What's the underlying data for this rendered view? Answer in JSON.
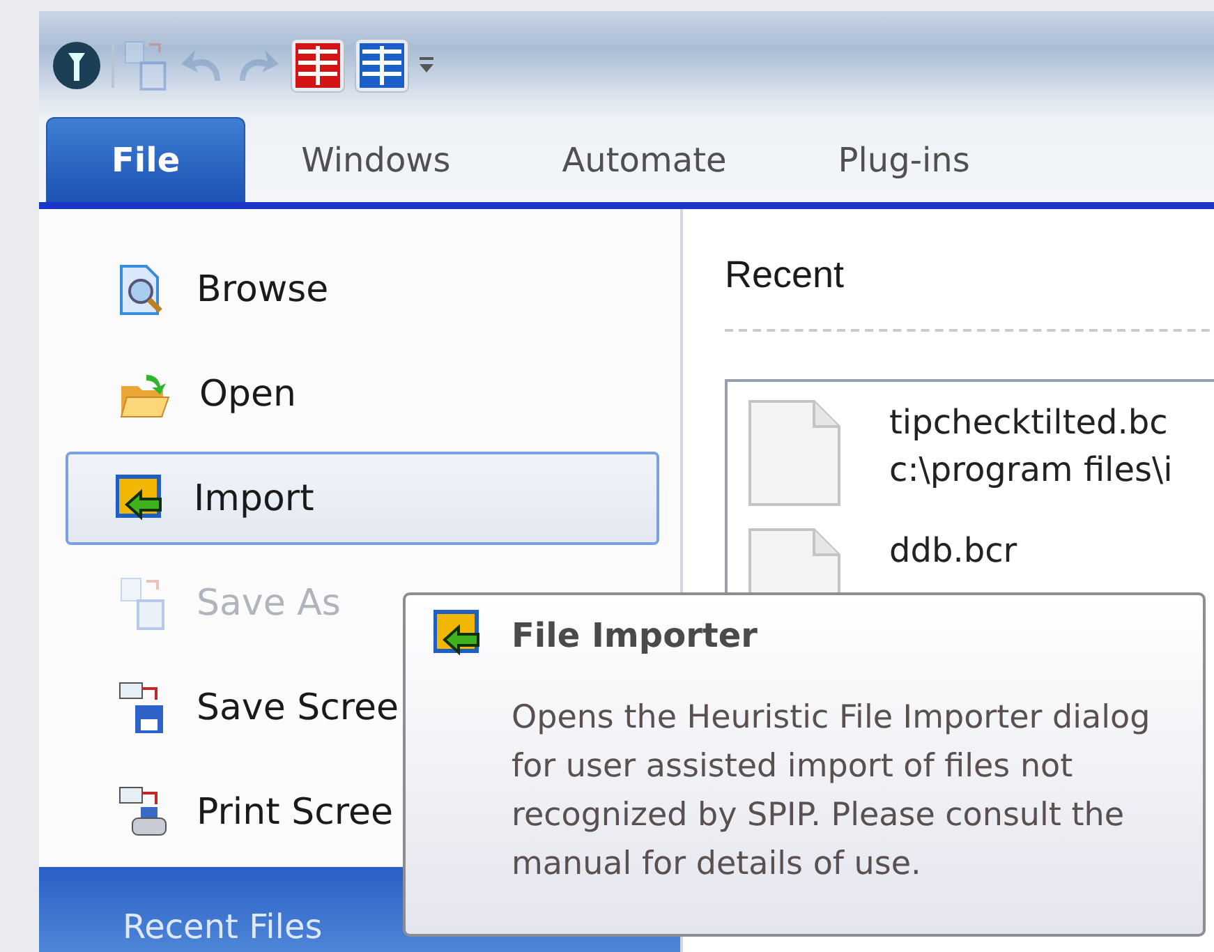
{
  "quick_access": [
    {
      "kind": "logo",
      "disabled": false
    },
    {
      "kind": "save",
      "disabled": true
    },
    {
      "kind": "undo",
      "disabled": true
    },
    {
      "kind": "redo",
      "disabled": true
    },
    {
      "kind": "red-grid",
      "disabled": false
    },
    {
      "kind": "blue-grid",
      "disabled": false
    },
    {
      "kind": "customize",
      "disabled": false
    }
  ],
  "tabs": [
    {
      "label": "File",
      "selected": true
    },
    {
      "label": "Windows",
      "selected": false
    },
    {
      "label": "Automate",
      "selected": false
    },
    {
      "label": "Plug-ins",
      "selected": false
    }
  ],
  "menu": {
    "items": [
      {
        "kind": "browse",
        "label": "Browse",
        "disabled": false,
        "selected": false
      },
      {
        "kind": "open",
        "label": "Open",
        "disabled": false,
        "selected": false
      },
      {
        "kind": "import",
        "label": "Import",
        "disabled": false,
        "selected": true
      },
      {
        "kind": "save-as",
        "label": "Save As",
        "disabled": true,
        "selected": false
      },
      {
        "kind": "save-screen",
        "label": "Save Scree",
        "disabled": false,
        "selected": false
      },
      {
        "kind": "print-screen",
        "label": "Print Scree",
        "disabled": false,
        "selected": false
      }
    ],
    "footer": "Recent Files"
  },
  "recent": {
    "title": "Recent",
    "files": [
      {
        "name": "tipchecktilted.bc",
        "path": "c:\\program files\\i"
      },
      {
        "name": "ddb.bcr"
      }
    ]
  },
  "tooltip": {
    "title": "File Importer",
    "body": "Opens the Heuristic File Importer dialog for user assisted import of files not recognized by SPIP. Please consult the manual for details of use."
  }
}
